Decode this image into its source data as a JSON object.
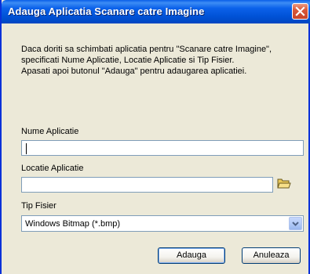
{
  "dialog": {
    "title": "Adauga Aplicatia Scanare catre Imagine",
    "close_icon": "close-icon",
    "description": [
      "Daca doriti sa schimbati aplicatia pentru \"Scanare catre Imagine\",",
      "specificati Nume Aplicatie, Locatie Aplicatie si Tip Fisier.",
      "Apasati apoi butonul \"Adauga\" pentru adaugarea aplicatiei."
    ]
  },
  "fields": {
    "name_label": "Nume Aplicatie",
    "name_value": "",
    "location_label": "Locatie Aplicatie",
    "location_value": "",
    "browse_icon": "folder-open-icon",
    "type_label": "Tip Fisier",
    "type_value": "Windows Bitmap (*.bmp)"
  },
  "buttons": {
    "add": "Adauga",
    "cancel": "Anuleaza"
  },
  "colors": {
    "titlebar": "#0054e3",
    "dialog_bg": "#ece9d8",
    "close_button": "#d9583a"
  }
}
